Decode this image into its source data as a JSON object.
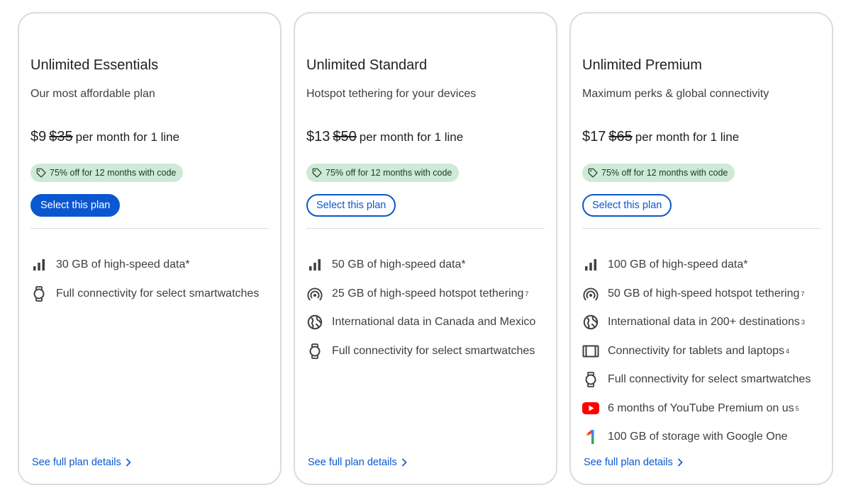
{
  "plans": [
    {
      "name": "Unlimited Essentials",
      "description": "Our most affordable plan",
      "price": "$9",
      "old_price": "$35",
      "per": "per month for 1 line",
      "promo": "75% off for 12 months with code",
      "button_label": "Select this plan",
      "button_style": "primary",
      "features": [
        {
          "icon": "signal-bars-icon",
          "text": "30 GB of high-speed data*",
          "sup": ""
        },
        {
          "icon": "smartwatch-icon",
          "text": "Full connectivity for select smartwatches",
          "sup": ""
        }
      ],
      "details_label": "See full plan details"
    },
    {
      "name": "Unlimited Standard",
      "description": "Hotspot tethering for your devices",
      "price": "$13",
      "old_price": "$50",
      "per": "per month for 1 line",
      "promo": "75% off for 12 months with code",
      "button_label": "Select this plan",
      "button_style": "outline",
      "features": [
        {
          "icon": "signal-bars-icon",
          "text": "50 GB of high-speed data*",
          "sup": ""
        },
        {
          "icon": "hotspot-icon",
          "text": "25 GB of high-speed hotspot tethering",
          "sup": "7"
        },
        {
          "icon": "globe-icon",
          "text": "International data in Canada and Mexico",
          "sup": ""
        },
        {
          "icon": "smartwatch-icon",
          "text": "Full connectivity for select smartwatches",
          "sup": ""
        }
      ],
      "details_label": "See full plan details"
    },
    {
      "name": "Unlimited Premium",
      "description": "Maximum perks & global connectivity",
      "price": "$17",
      "old_price": "$65",
      "per": "per month for 1 line",
      "promo": "75% off for 12 months with code",
      "button_label": "Select this plan",
      "button_style": "outline",
      "features": [
        {
          "icon": "signal-bars-icon",
          "text": "100 GB of high-speed data*",
          "sup": ""
        },
        {
          "icon": "hotspot-icon",
          "text": "50 GB of high-speed hotspot tethering",
          "sup": "7"
        },
        {
          "icon": "globe-icon",
          "text": "International data in 200+ destinations",
          "sup": "3"
        },
        {
          "icon": "tablet-laptop-icon",
          "text": "Connectivity for tablets and laptops",
          "sup": "4"
        },
        {
          "icon": "smartwatch-icon",
          "text": "Full connectivity for select smartwatches",
          "sup": ""
        },
        {
          "icon": "youtube-icon",
          "text": "6 months of YouTube Premium on us",
          "sup": "5"
        },
        {
          "icon": "google-one-icon",
          "text": "100 GB of storage with Google One",
          "sup": ""
        }
      ],
      "details_label": "See full plan details"
    }
  ],
  "colors": {
    "accent": "#0b57d0",
    "promo_bg": "#ceead6",
    "border": "#dadce0",
    "youtube_red": "#ff0000"
  }
}
